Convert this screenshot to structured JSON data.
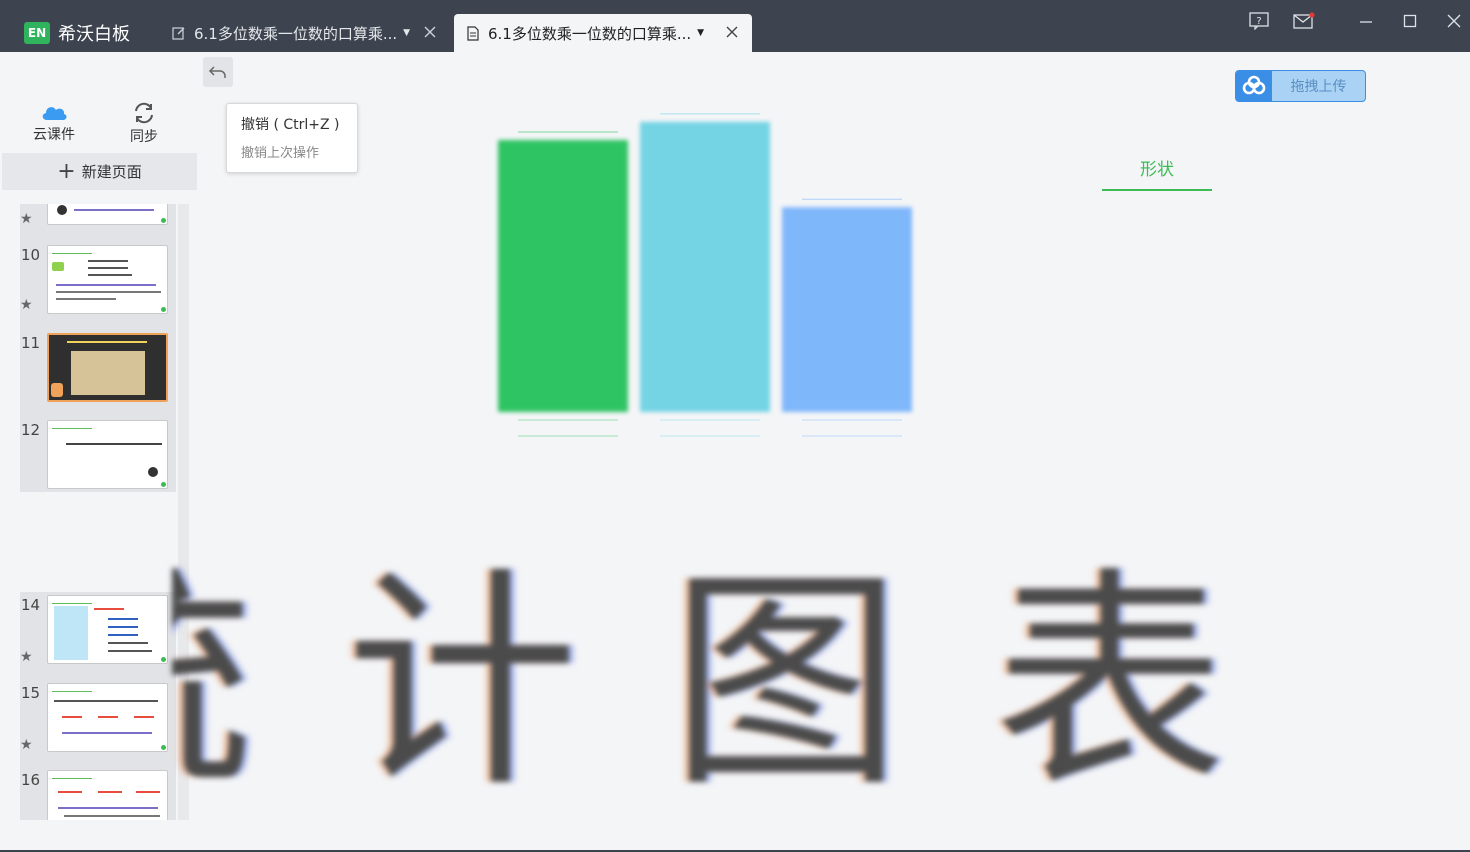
{
  "app": {
    "logo_text": "EN",
    "name": "希沃白板"
  },
  "tabs": [
    {
      "title": "6.1多位数乘一位数的口算乘...",
      "icon": "edit-icon",
      "active": false
    },
    {
      "title": "6.1多位数乘一位数的口算乘...",
      "icon": "document-icon",
      "active": true
    }
  ],
  "sidebar": {
    "cloud_label": "云课件",
    "sync_label": "同步",
    "new_page_label": "新建页面",
    "thumbnails": [
      {
        "num": "10"
      },
      {
        "num": "11"
      },
      {
        "num": "12"
      },
      {
        "num": "14"
      },
      {
        "num": "15"
      },
      {
        "num": "16"
      }
    ]
  },
  "tooltip": {
    "title": "撤销 ( Ctrl+Z )",
    "desc": "撤销上次操作"
  },
  "upload": {
    "label": "拖拽上传"
  },
  "shape_tab": {
    "label": "形状"
  },
  "canvas": {
    "big_text": "统计图表"
  },
  "chart_data": {
    "type": "bar",
    "categories": [
      "",
      "",
      ""
    ],
    "values": [
      255,
      272,
      192
    ],
    "colors": [
      "#2fc463",
      "#74d4e4",
      "#7fb7fb"
    ],
    "title": "",
    "xlabel": "",
    "ylabel": ""
  },
  "colors": {
    "titlebar": "#3d4450",
    "accent": "#3dbb55",
    "upload_blue": "#3a8ee6"
  }
}
